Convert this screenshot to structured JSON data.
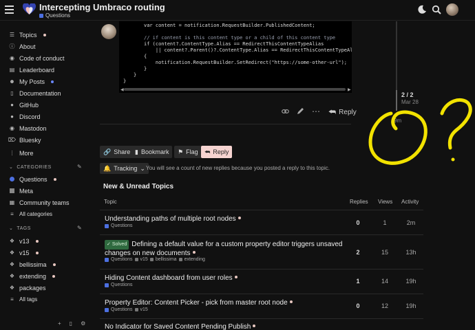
{
  "header": {
    "title": "Intercepting Umbraco routing",
    "category": "Questions",
    "category_color": "#4c6fe0"
  },
  "sidebar": {
    "items": [
      {
        "label": "Topics",
        "icon": "layers-icon",
        "dot": true
      },
      {
        "label": "About",
        "icon": "info-icon",
        "dot": false
      },
      {
        "label": "Code of conduct",
        "icon": "shield-icon",
        "dot": false
      },
      {
        "label": "Leaderboard",
        "icon": "trophy-icon",
        "dot": false
      },
      {
        "label": "My Posts",
        "icon": "user-icon",
        "dot": true
      },
      {
        "label": "Documentation",
        "icon": "book-icon",
        "dot": false
      },
      {
        "label": "GitHub",
        "icon": "github-icon",
        "dot": false
      },
      {
        "label": "Discord",
        "icon": "discord-icon",
        "dot": false
      },
      {
        "label": "Mastodon",
        "icon": "mastodon-icon",
        "dot": false
      },
      {
        "label": "Bluesky",
        "icon": "bluesky-icon",
        "dot": false
      },
      {
        "label": "More",
        "icon": "more-icon",
        "dot": false
      }
    ],
    "categories_title": "CATEGORIES",
    "categories": [
      {
        "label": "Questions",
        "color": "#4c6fe0",
        "dot": true
      },
      {
        "label": "Meta",
        "color": "#888888",
        "dot": false
      },
      {
        "label": "Community teams",
        "color": "grid",
        "dot": false
      },
      {
        "label": "All categories",
        "color": "list",
        "dot": false
      }
    ],
    "tags_title": "TAGS",
    "tags": [
      {
        "label": "v13",
        "dot": true
      },
      {
        "label": "v15",
        "dot": true
      },
      {
        "label": "bellissima",
        "dot": true
      },
      {
        "label": "extending",
        "dot": true
      },
      {
        "label": "packages",
        "dot": false
      },
      {
        "label": "All tags",
        "dot": false
      }
    ]
  },
  "code": {
    "lines": [
      {
        "text": "var content = notification.RequestBuilder.PublishedContent;",
        "type": "code",
        "indent": 36
      },
      {
        "text": "// if content is this content type or a child of this content type",
        "type": "comment",
        "indent": 36
      },
      {
        "text": "if (content?.ContentType.Alias == RedirectThisContentTypeAlias",
        "type": "code",
        "indent": 36
      },
      {
        "text": "    || content?.Parent()?.ContentType.Alias == RedirectThisContentTypeAlias)",
        "type": "code",
        "indent": 36
      },
      {
        "text": "{",
        "type": "code",
        "indent": 36
      },
      {
        "text": "    notification.RequestBuilder.SetRedirect(\"https://some-other-url\");",
        "type": "code",
        "indent": 36
      },
      {
        "text": "}",
        "type": "code",
        "indent": 36
      },
      {
        "text": "}",
        "type": "code",
        "indent": 21
      },
      {
        "text": "}",
        "type": "code",
        "indent": 6
      }
    ]
  },
  "post_actions": {
    "reply_label": "Reply"
  },
  "timeline": {
    "count": "2 / 2",
    "date": "Mar 28",
    "ago": "9m"
  },
  "footer_buttons": {
    "share": "Share",
    "bookmark": "Bookmark",
    "flag": "Flag",
    "reply": "Reply"
  },
  "tracking": {
    "label": "Tracking",
    "note": "You will see a count of new replies because you posted a reply to this topic."
  },
  "topic_list": {
    "title": "New & Unread Topics",
    "headers": {
      "topic": "Topic",
      "replies": "Replies",
      "views": "Views",
      "activity": "Activity"
    },
    "rows": [
      {
        "title": "Understanding paths of multiple root nodes",
        "solved": "",
        "category": "Questions",
        "tags": [],
        "replies": "0",
        "views": "1",
        "activity": "2m"
      },
      {
        "title": "Defining a default value for a custom property editor triggers unsaved changes on new documents",
        "solved": "Solved",
        "category": "Questions",
        "tags": [
          "v15",
          "bellissima",
          "extending"
        ],
        "replies": "2",
        "views": "15",
        "activity": "13h"
      },
      {
        "title": "Hiding Content dashboard from user roles",
        "solved": "",
        "category": "Questions",
        "tags": [],
        "replies": "1",
        "views": "14",
        "activity": "19h"
      },
      {
        "title": "Property Editor: Content Picker - pick from master root node",
        "solved": "",
        "category": "Questions",
        "tags": [
          "v15"
        ],
        "replies": "0",
        "views": "12",
        "activity": "19h"
      },
      {
        "title": "No Indicator for Saved Content Pending Publish",
        "solved": "",
        "category": "",
        "tags": [],
        "replies": "",
        "views": "",
        "activity": ""
      }
    ]
  },
  "annotation_color": "#f2e200"
}
